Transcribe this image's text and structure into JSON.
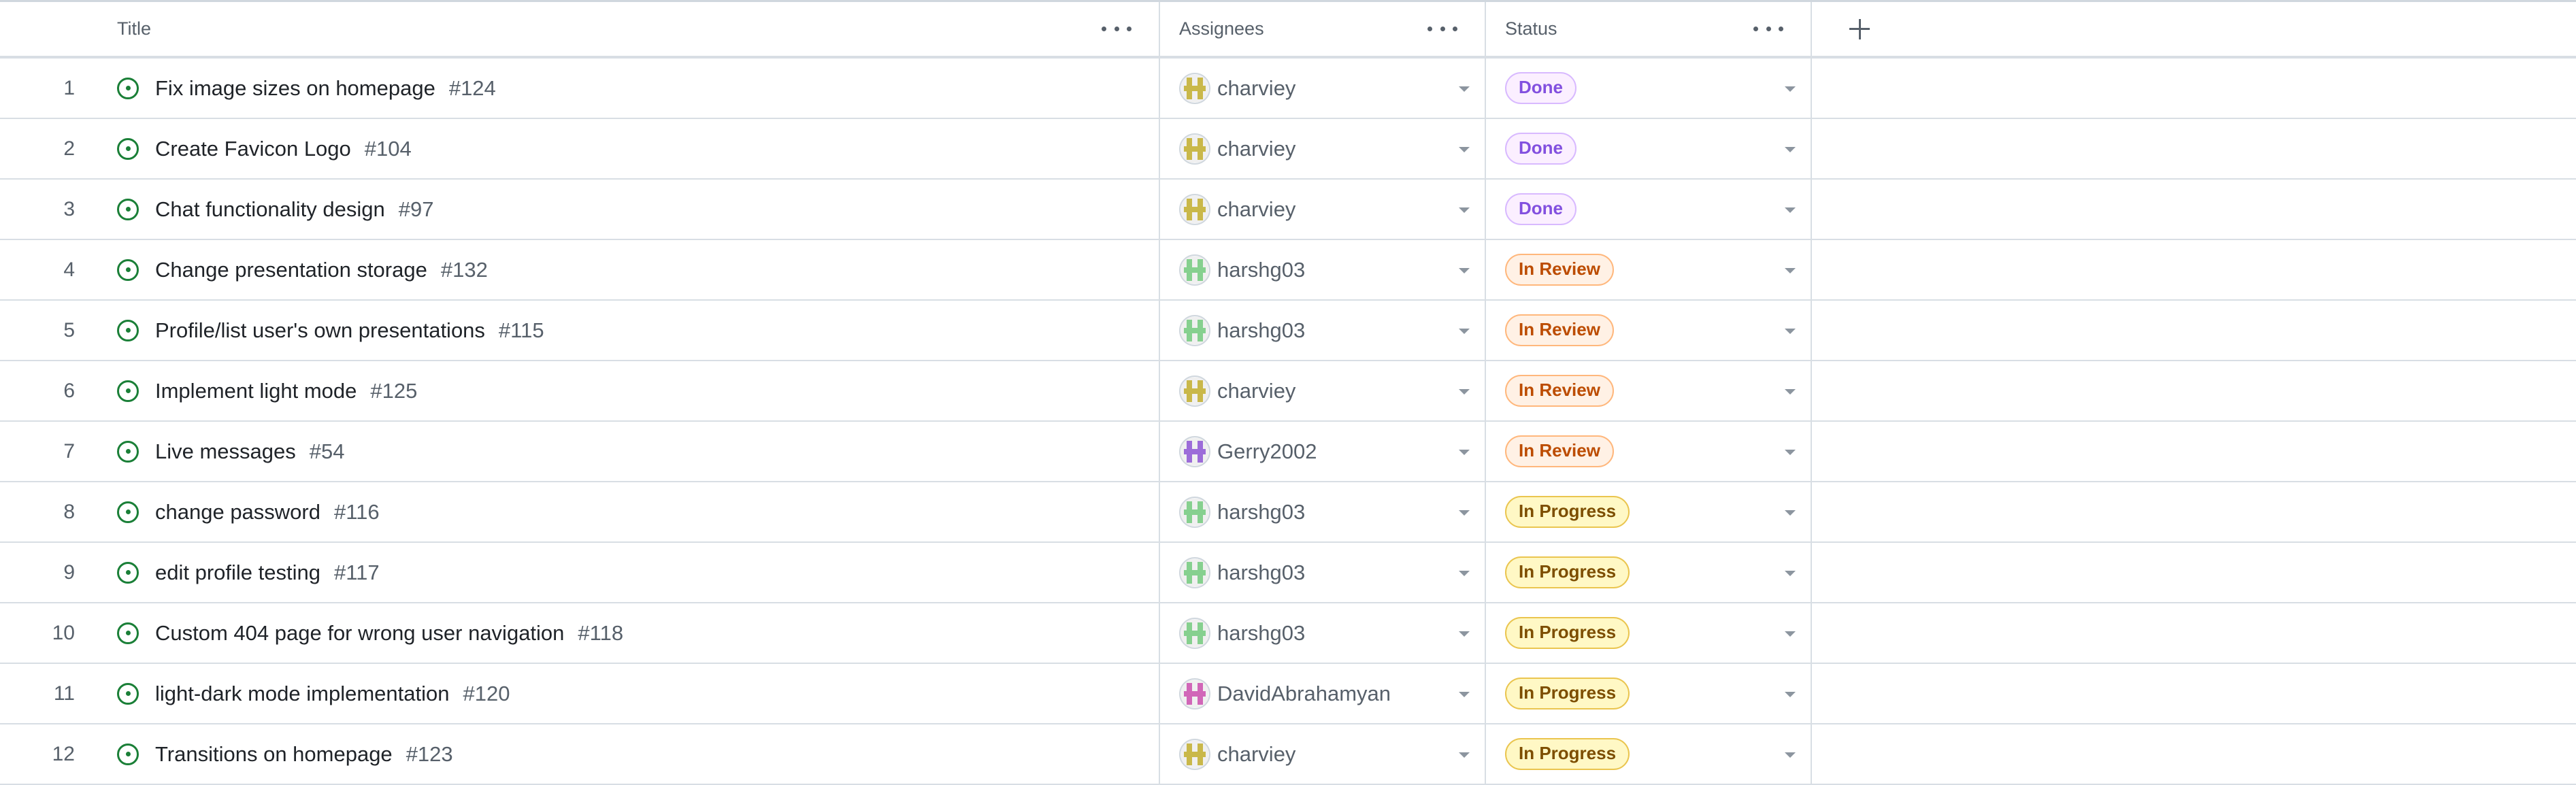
{
  "header": {
    "title": "Title",
    "assignees": "Assignees",
    "status": "Status"
  },
  "status_styles": {
    "Done": {
      "bg": "#fbefff",
      "border": "#d8b9ff",
      "fg": "#8250df"
    },
    "In Review": {
      "bg": "#fff1e5",
      "border": "#ffb77c",
      "fg": "#bc4c00"
    },
    "In Progress": {
      "bg": "#fff8c5",
      "border": "#eac54f",
      "fg": "#7d4e00"
    }
  },
  "avatar_colors": {
    "charviey": "#c9b84a",
    "harshg03": "#86d08f",
    "Gerry2002": "#9c6cd9",
    "DavidAbrahamyan": "#d166b8"
  },
  "rows": [
    {
      "index": "1",
      "title": "Fix image sizes on homepage",
      "number": "#124",
      "assignee": "charviey",
      "status": "Done"
    },
    {
      "index": "2",
      "title": "Create Favicon Logo",
      "number": "#104",
      "assignee": "charviey",
      "status": "Done"
    },
    {
      "index": "3",
      "title": "Chat functionality design",
      "number": "#97",
      "assignee": "charviey",
      "status": "Done"
    },
    {
      "index": "4",
      "title": "Change presentation storage",
      "number": "#132",
      "assignee": "harshg03",
      "status": "In Review"
    },
    {
      "index": "5",
      "title": "Profile/list user's own presentations",
      "number": "#115",
      "assignee": "harshg03",
      "status": "In Review"
    },
    {
      "index": "6",
      "title": "Implement light mode",
      "number": "#125",
      "assignee": "charviey",
      "status": "In Review"
    },
    {
      "index": "7",
      "title": "Live messages",
      "number": "#54",
      "assignee": "Gerry2002",
      "status": "In Review"
    },
    {
      "index": "8",
      "title": "change password",
      "number": "#116",
      "assignee": "harshg03",
      "status": "In Progress"
    },
    {
      "index": "9",
      "title": "edit profile testing",
      "number": "#117",
      "assignee": "harshg03",
      "status": "In Progress"
    },
    {
      "index": "10",
      "title": "Custom 404 page for wrong user navigation",
      "number": "#118",
      "assignee": "harshg03",
      "status": "In Progress"
    },
    {
      "index": "11",
      "title": "light-dark mode implementation",
      "number": "#120",
      "assignee": "DavidAbrahamyan",
      "status": "In Progress"
    },
    {
      "index": "12",
      "title": "Transitions on homepage",
      "number": "#123",
      "assignee": "charviey",
      "status": "In Progress"
    }
  ]
}
